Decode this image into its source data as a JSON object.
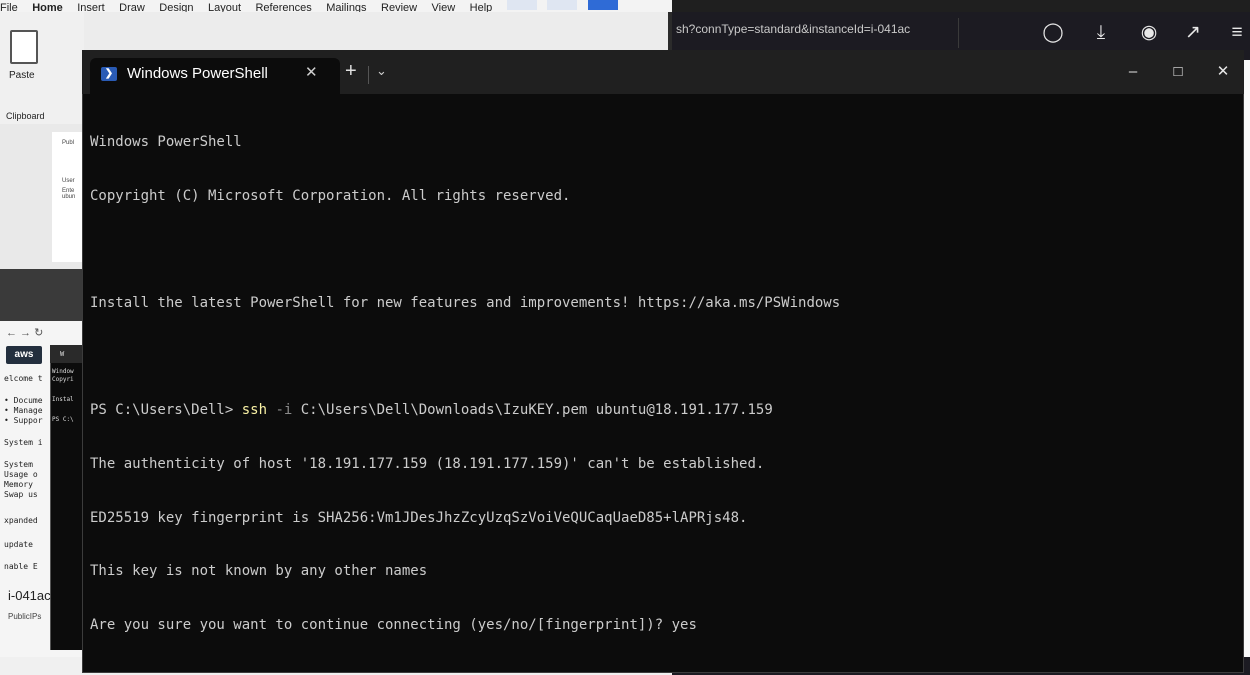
{
  "word": {
    "menu": [
      "File",
      "Home",
      "Insert",
      "Draw",
      "Design",
      "Layout",
      "References",
      "Mailings",
      "Review",
      "View",
      "Help"
    ],
    "paste_label": "Paste",
    "clipboard_label": "Clipboard",
    "doc_text": [
      "Publ",
      "User",
      "Ente",
      "ubun"
    ]
  },
  "firefox": {
    "url_fragment": "sh?connType=standard&instanceId=i-041ac"
  },
  "background_browser": {
    "aws_label": "aws",
    "lines": [
      "elcome t",
      "• Docume",
      "• Manage",
      "• Suppor",
      "System i",
      "System",
      "Usage o",
      "Memory",
      "Swap us",
      "xpanded",
      "update",
      "nable E"
    ],
    "mini_term_tab": "W",
    "mini_term_lines": [
      "Window",
      "Copyri",
      "Instal",
      "PS C:\\"
    ],
    "instance_id": "i-041ac",
    "public_ips": "PublicIPs"
  },
  "terminal": {
    "tab_title": "Windows PowerShell",
    "lines": {
      "l1": "Windows PowerShell",
      "l2": "Copyright (C) Microsoft Corporation. All rights reserved.",
      "l4": "Install the latest PowerShell for new features and improvements! https://aka.ms/PSWindows",
      "l6_prompt": "PS C:\\Users\\Dell> ",
      "l6_cmd": "ssh",
      "l6_flag": " -i",
      "l6_args": " C:\\Users\\Dell\\Downloads\\IzuKEY.pem ubuntu@18.191.177.159",
      "l7": "The authenticity of host '18.191.177.159 (18.191.177.159)' can't be established.",
      "l8": "ED25519 key fingerprint is SHA256:Vm1JDesJhzZcyUzqSzVoiVeQUCaqUaeD85+lAPRjs48.",
      "l9": "This key is not known by any other names",
      "l10": "Are you sure you want to continue connecting (yes/no/[fingerprint])? yes"
    }
  },
  "colors": {
    "terminal_bg": "#0c0c0c",
    "terminal_fg": "#cccccc",
    "command_highlight": "#f9f1a5",
    "titlebar_bg": "#202020"
  }
}
